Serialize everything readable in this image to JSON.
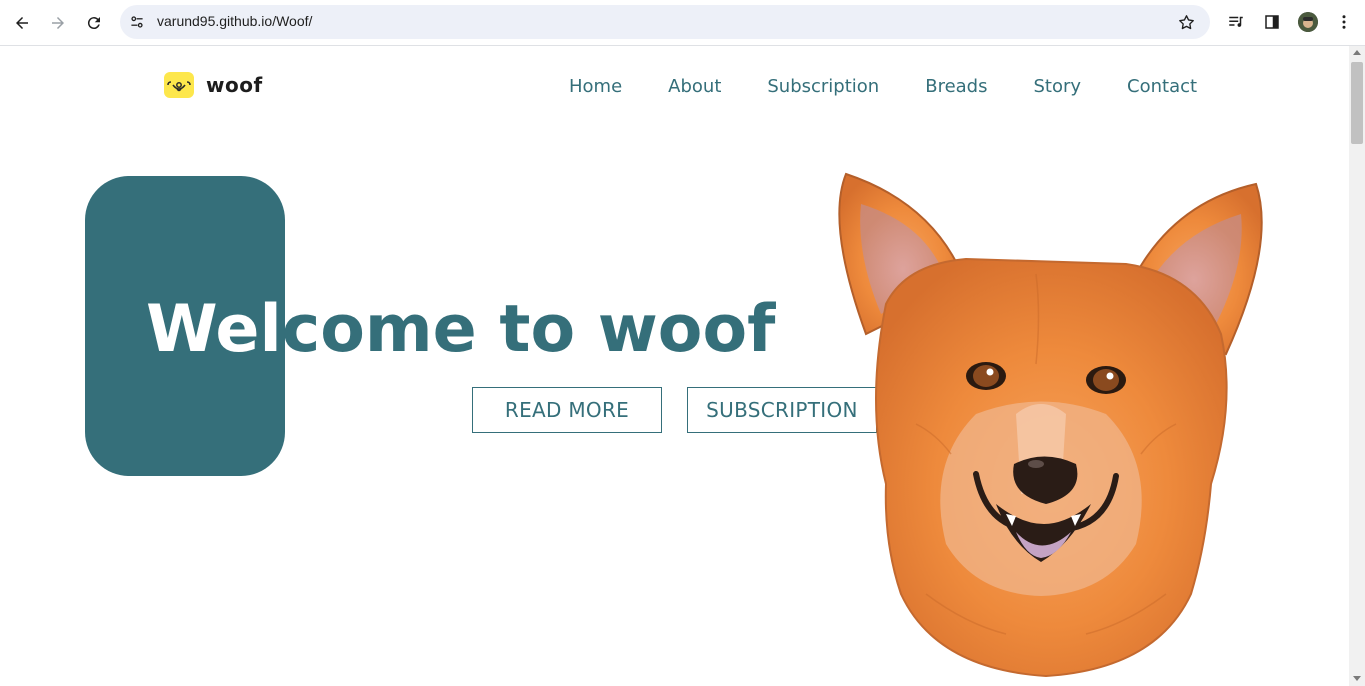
{
  "browser": {
    "url": "varund95.github.io/Woof/",
    "icons": {
      "back": "arrow-left-icon",
      "forward": "arrow-right-icon",
      "reload": "reload-icon",
      "site_info": "tune-icon",
      "bookmark": "star-icon",
      "media": "media-queue-icon",
      "side_panel": "side-panel-icon",
      "menu": "more-vert-icon"
    }
  },
  "site": {
    "logo_text": "woof",
    "nav": [
      {
        "label": "Home"
      },
      {
        "label": "About"
      },
      {
        "label": "Subscription"
      },
      {
        "label": "Breads"
      },
      {
        "label": "Story"
      },
      {
        "label": "Contact"
      }
    ]
  },
  "hero": {
    "title_part_light": "Wel",
    "title_part_dark": "come to woof",
    "read_more_label": "READ MORE",
    "subscription_label": "SUBSCRIPTION"
  },
  "colors": {
    "brand_teal": "#356f7a",
    "logo_yellow": "#fde74c",
    "omnibox": "#edf0f8"
  }
}
